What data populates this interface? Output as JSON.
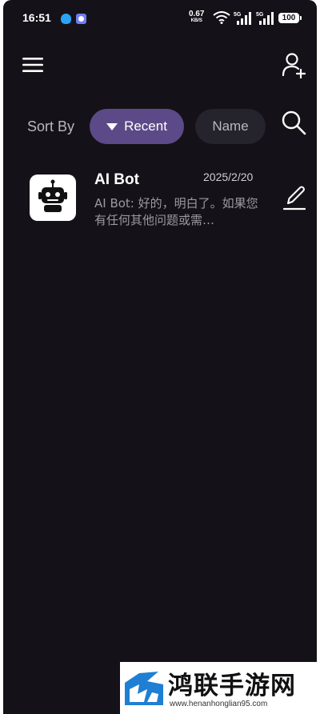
{
  "status_bar": {
    "time": "16:51",
    "net_speed": "0.67",
    "net_unit": "KB/S",
    "signal_1": "5G",
    "signal_2": "5G",
    "battery": "100",
    "icons": [
      "qq-icon",
      "app-icon",
      "wifi-icon",
      "signal-icon",
      "signal-icon",
      "battery-icon"
    ]
  },
  "header": {
    "menu_icon": "hamburger-menu-icon",
    "add_user_icon": "add-user-icon"
  },
  "sort": {
    "label": "Sort By",
    "options": [
      {
        "label": "Recent",
        "selected": true,
        "icon": "triangle-down-icon"
      },
      {
        "label": "Name",
        "selected": false
      }
    ],
    "search_icon": "search-icon"
  },
  "chats": [
    {
      "name": "AI Bot",
      "date": "2025/2/20",
      "preview": "AI Bot: 好的，明白了。如果您有任何其他问题或需…",
      "avatar_icon": "robot-icon",
      "edit_icon": "edit-pencil-icon"
    }
  ],
  "colors": {
    "background": "#141218",
    "accent_chip": "#5b4a87",
    "inactive_chip": "#25232b"
  },
  "watermark": {
    "title": "鸿联手游网",
    "url": "www.henanhonglian95.com"
  }
}
